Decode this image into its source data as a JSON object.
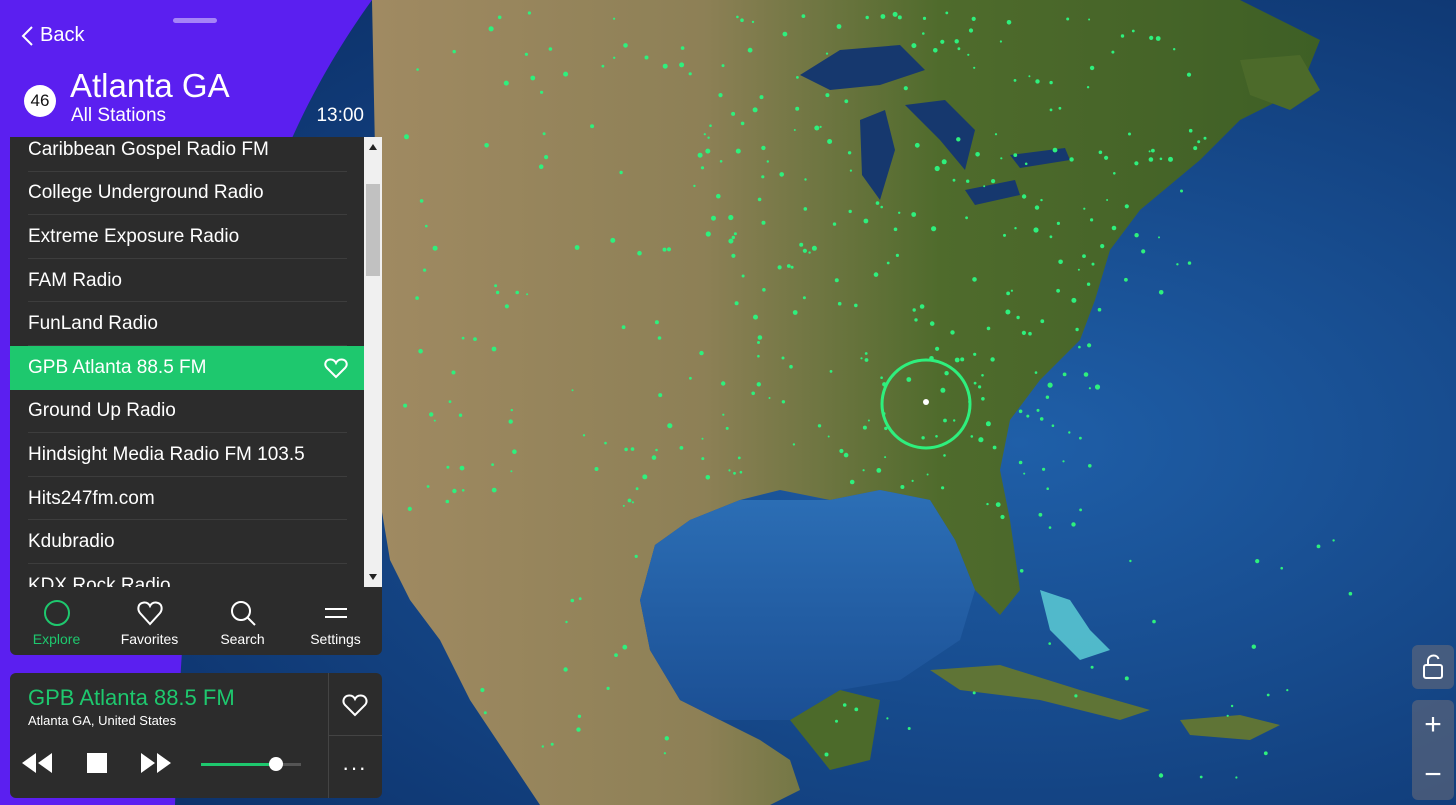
{
  "header": {
    "back_label": "Back",
    "station_count": "46",
    "city": "Atlanta GA",
    "subtitle": "All Stations",
    "time": "13:00"
  },
  "stations": [
    {
      "name": "Caribbean Gospel Radio FM",
      "selected": false
    },
    {
      "name": "College Underground Radio",
      "selected": false
    },
    {
      "name": "Extreme Exposure Radio",
      "selected": false
    },
    {
      "name": "FAM Radio",
      "selected": false
    },
    {
      "name": "FunLand Radio",
      "selected": false
    },
    {
      "name": "GPB Atlanta 88.5 FM",
      "selected": true
    },
    {
      "name": "Ground Up Radio",
      "selected": false
    },
    {
      "name": "Hindsight Media Radio FM 103.5",
      "selected": false
    },
    {
      "name": "Hits247fm.com",
      "selected": false
    },
    {
      "name": "Kdubradio",
      "selected": false
    },
    {
      "name": "KDX Rock Radio",
      "selected": false
    }
  ],
  "nav": [
    {
      "label": "Explore",
      "icon": "circle-icon",
      "active": true
    },
    {
      "label": "Favorites",
      "icon": "heart-icon",
      "active": false
    },
    {
      "label": "Search",
      "icon": "search-icon",
      "active": false
    },
    {
      "label": "Settings",
      "icon": "menu-icon",
      "active": false
    }
  ],
  "player": {
    "station": "GPB Atlanta 88.5 FM",
    "location": "Atlanta GA, United States",
    "volume": 0.75,
    "more_label": "···"
  },
  "map_controls": {
    "lock_icon": "unlock-icon",
    "zoom_in": "+",
    "zoom_out": "−"
  },
  "colors": {
    "accent": "#1ec86e",
    "purple": "#5b1ff0",
    "panel": "#2c2c2c"
  }
}
